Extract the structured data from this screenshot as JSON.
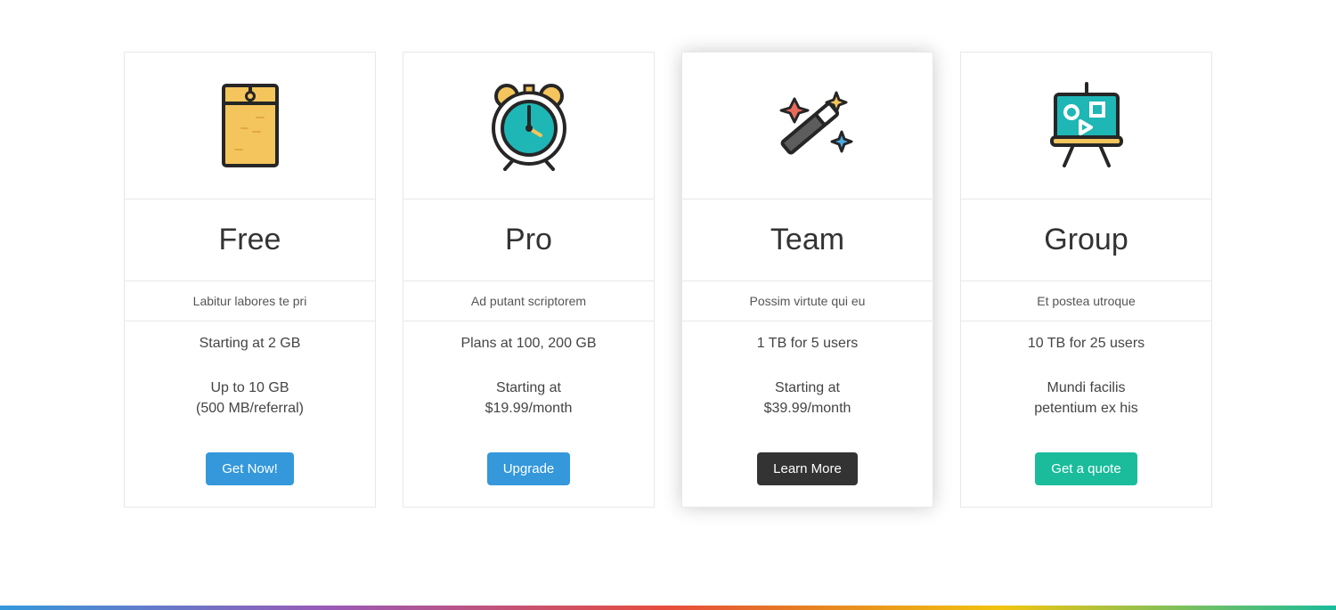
{
  "plans": [
    {
      "title": "Free",
      "tagline": "Labitur labores te pri",
      "spec1_line1": "Starting at 2 GB",
      "spec2_line1": "Up to 10 GB",
      "spec2_line2": "(500 MB/referral)",
      "cta": "Get Now!"
    },
    {
      "title": "Pro",
      "tagline": "Ad putant scriptorem",
      "spec1_line1": "Plans at 100, 200 GB",
      "spec2_line1": "Starting at",
      "spec2_line2": "$19.99/month",
      "cta": "Upgrade"
    },
    {
      "title": "Team",
      "tagline": "Possim virtute qui eu",
      "spec1_line1": "1 TB for 5 users",
      "spec2_line1": "Starting at",
      "spec2_line2": "$39.99/month",
      "cta": "Learn More"
    },
    {
      "title": "Group",
      "tagline": "Et postea utroque",
      "spec1_line1": "10 TB for 25 users",
      "spec2_line1": "Mundi facilis",
      "spec2_line2": "petentium ex his",
      "cta": "Get a quote"
    }
  ]
}
